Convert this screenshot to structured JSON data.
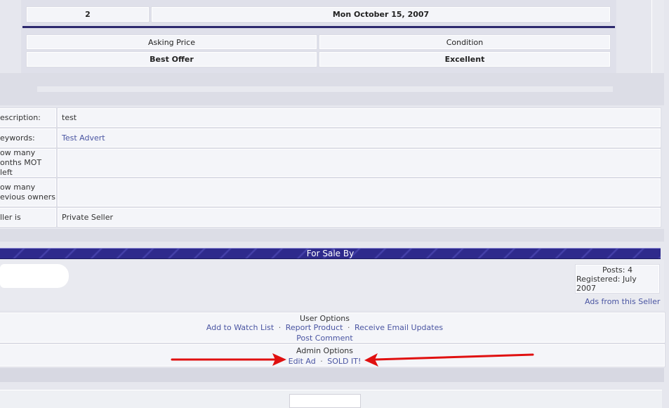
{
  "summary_table": {
    "id_value": "2",
    "date_value": "Mon October 15, 2007",
    "asking_price_header": "Asking Price",
    "condition_header": "Condition",
    "asking_price_value": "Best Offer",
    "condition_value": "Excellent"
  },
  "details": [
    {
      "label": "escription:",
      "value": "test",
      "is_link": false
    },
    {
      "label": "eywords:",
      "value": "Test Advert",
      "is_link": true
    },
    {
      "label": "ow many\nonths MOT left",
      "value": "",
      "is_link": false
    },
    {
      "label": "ow many\nevious owners",
      "value": "",
      "is_link": false
    },
    {
      "label": "ller is",
      "value": "Private Seller",
      "is_link": false
    }
  ],
  "seller": {
    "banner_title": "For Sale By",
    "posts": "Posts: 4",
    "registered": "Registered: July 2007",
    "ads_link": "Ads from this Seller"
  },
  "user_options": {
    "title": "User Options",
    "add_watch": "Add to Watch List",
    "report": "Report Product",
    "email_updates": "Receive Email Updates",
    "post_comment": "Post Comment",
    "separator": "·"
  },
  "admin_options": {
    "title": "Admin Options",
    "edit_ad": "Edit Ad",
    "sold_it": "SOLD IT!",
    "separator": "·"
  },
  "colors": {
    "annotation_arrow": "#e01010",
    "banner": "#2e2a8c",
    "link": "#4a55a2"
  }
}
